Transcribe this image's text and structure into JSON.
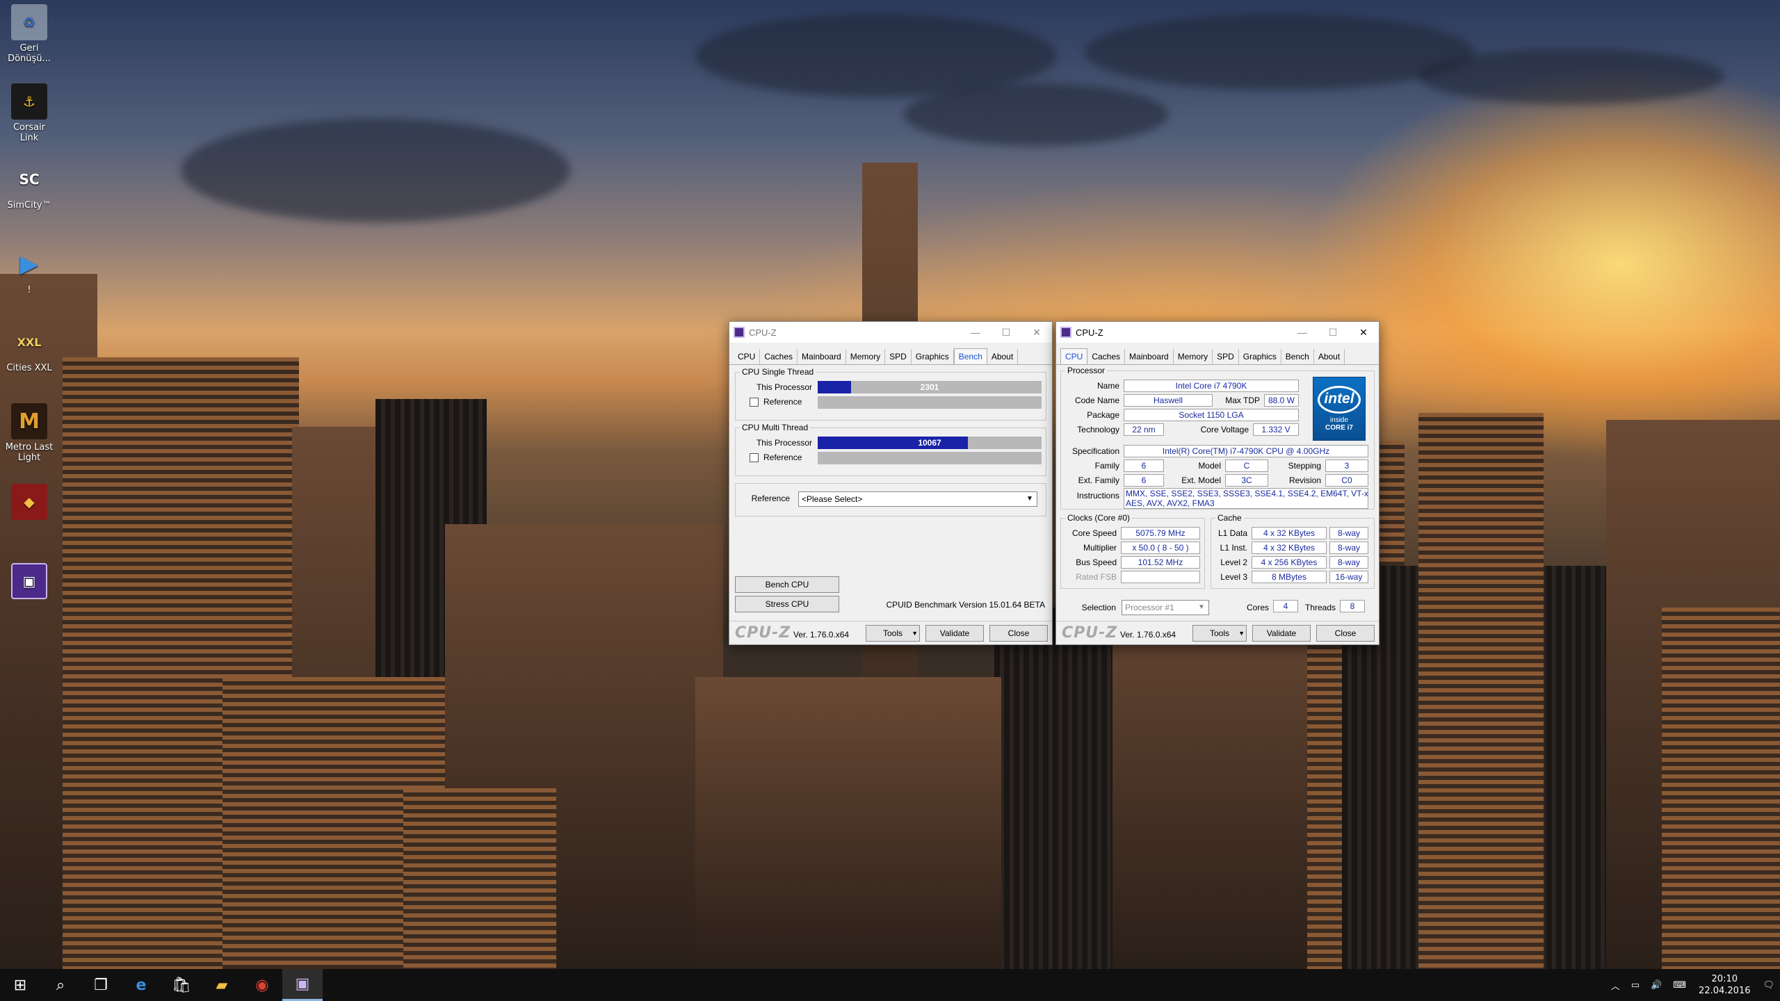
{
  "desktop": {
    "icons": [
      {
        "label": "Geri Dönüşü..."
      },
      {
        "label": "Corsair Link"
      },
      {
        "label": "SimCity™"
      },
      {
        "label": "!"
      },
      {
        "label": "Cities XXL"
      },
      {
        "label": "Metro Last Light"
      },
      {
        "label": ""
      },
      {
        "label": ""
      }
    ]
  },
  "bench_window": {
    "title": "CPU-Z",
    "tabs": [
      "CPU",
      "Caches",
      "Mainboard",
      "Memory",
      "SPD",
      "Graphics",
      "Bench",
      "About"
    ],
    "selected_tab": "Bench",
    "single_thread": {
      "group_label": "CPU Single Thread",
      "this_processor_label": "This Processor",
      "this_processor_value": "2301",
      "this_processor_fraction": 0.15,
      "reference_label": "Reference"
    },
    "multi_thread": {
      "group_label": "CPU Multi Thread",
      "this_processor_label": "This Processor",
      "this_processor_value": "10067",
      "this_processor_fraction": 0.67,
      "reference_label": "Reference"
    },
    "reference": {
      "label": "Reference",
      "selected": "<Please Select>"
    },
    "bench_cpu_label": "Bench CPU",
    "stress_cpu_label": "Stress CPU",
    "benchmark_version": "CPUID Benchmark Version 15.01.64 BETA",
    "footer": {
      "logo": "CPU-Z",
      "version": "Ver. 1.76.0.x64",
      "tools_label": "Tools",
      "validate_label": "Validate",
      "close_label": "Close"
    }
  },
  "cpu_window": {
    "title": "CPU-Z",
    "tabs": [
      "CPU",
      "Caches",
      "Mainboard",
      "Memory",
      "SPD",
      "Graphics",
      "Bench",
      "About"
    ],
    "selected_tab": "CPU",
    "processor": {
      "group_label": "Processor",
      "name_label": "Name",
      "name": "Intel Core i7 4790K",
      "code_name_label": "Code Name",
      "code_name": "Haswell",
      "max_tdp_label": "Max TDP",
      "max_tdp": "88.0 W",
      "package_label": "Package",
      "package": "Socket 1150 LGA",
      "technology_label": "Technology",
      "technology": "22 nm",
      "core_voltage_label": "Core Voltage",
      "core_voltage": "1.332 V",
      "specification_label": "Specification",
      "specification": "Intel(R) Core(TM) i7-4790K CPU @ 4.00GHz",
      "family_label": "Family",
      "family": "6",
      "model_label": "Model",
      "model": "C",
      "stepping_label": "Stepping",
      "stepping": "3",
      "ext_family_label": "Ext. Family",
      "ext_family": "6",
      "ext_model_label": "Ext. Model",
      "ext_model": "3C",
      "revision_label": "Revision",
      "revision": "C0",
      "instructions_label": "Instructions",
      "instructions_line1": "MMX, SSE, SSE2, SSE3, SSSE3, SSE4.1, SSE4.2, EM64T, VT-x,",
      "instructions_line2": "AES, AVX, AVX2, FMA3"
    },
    "intel_badge": {
      "brand": "intel",
      "inside": "inside",
      "line": "CORE i7"
    },
    "clocks": {
      "group_label": "Clocks (Core #0)",
      "core_speed_label": "Core Speed",
      "core_speed": "5075.79 MHz",
      "multiplier_label": "Multiplier",
      "multiplier": "x 50.0 ( 8 - 50 )",
      "bus_speed_label": "Bus Speed",
      "bus_speed": "101.52 MHz",
      "rated_fsb_label": "Rated FSB",
      "rated_fsb": ""
    },
    "cache": {
      "group_label": "Cache",
      "rows": [
        {
          "label": "L1 Data",
          "size": "4 x 32 KBytes",
          "ways": "8-way"
        },
        {
          "label": "L1 Inst.",
          "size": "4 x 32 KBytes",
          "ways": "8-way"
        },
        {
          "label": "Level 2",
          "size": "4 x 256 KBytes",
          "ways": "8-way"
        },
        {
          "label": "Level 3",
          "size": "8 MBytes",
          "ways": "16-way"
        }
      ]
    },
    "selection_label": "Selection",
    "selection_value": "Processor #1",
    "cores_label": "Cores",
    "cores": "4",
    "threads_label": "Threads",
    "threads": "8",
    "footer": {
      "logo": "CPU-Z",
      "version": "Ver. 1.76.0.x64",
      "tools_label": "Tools",
      "validate_label": "Validate",
      "close_label": "Close"
    }
  },
  "taskbar": {
    "icons": [
      "windows-start-icon",
      "search-icon",
      "task-view-icon",
      "edge-icon",
      "store-icon",
      "file-explorer-icon",
      "chrome-icon",
      "cpu-z-icon"
    ],
    "clock_time": "20:10",
    "clock_date": "22.04.2016"
  }
}
